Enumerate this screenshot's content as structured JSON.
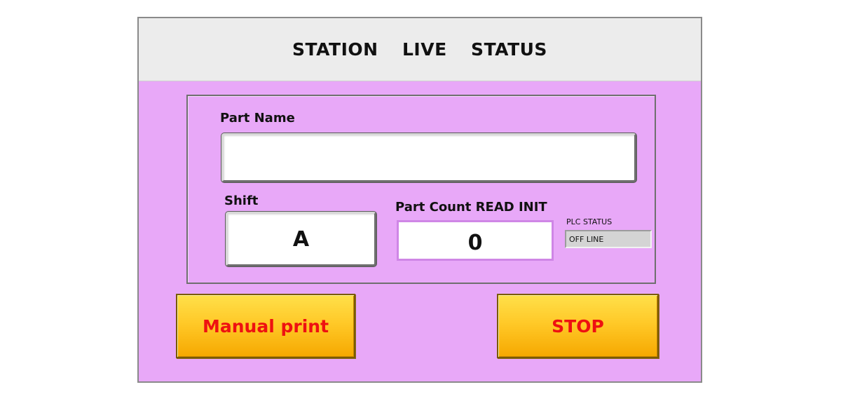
{
  "header": {
    "title": "STATION  LIVE  STATUS"
  },
  "station": {
    "part_name_label": "Part Name",
    "part_name_value": "",
    "shift_label": "Shift",
    "shift_value": "A",
    "part_count_label": "Part Count READ INIT",
    "part_count_value": "0",
    "plc_status_label": "PLC STATUS",
    "plc_status_value": "OFF LINE"
  },
  "buttons": {
    "manual_print_label": "Manual print",
    "stop_label": "STOP"
  },
  "colors": {
    "panel_background": "#e8a8f8",
    "header_background": "#ececec",
    "button_gradient_top": "#ffe04a",
    "button_gradient_bottom": "#f6a800",
    "button_text": "#ee1111"
  }
}
